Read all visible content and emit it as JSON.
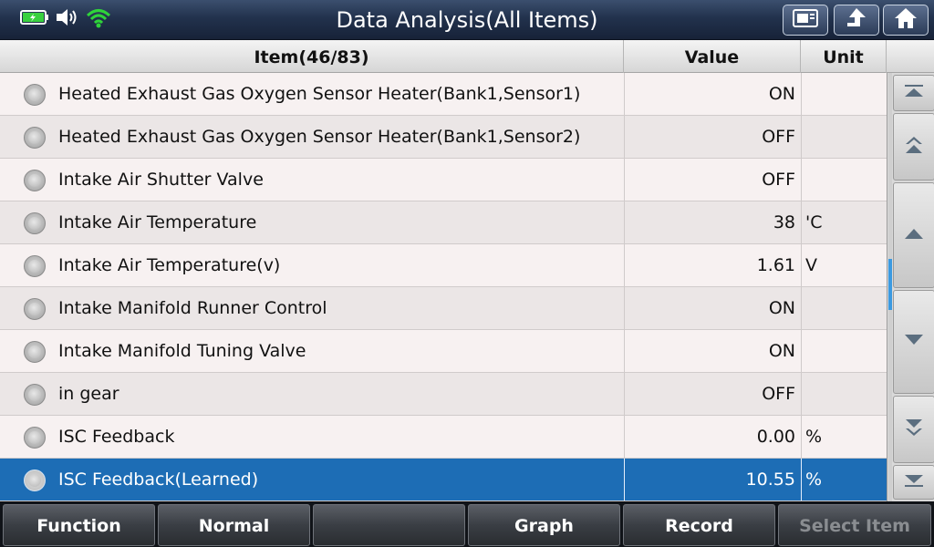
{
  "header": {
    "title": "Data Analysis(All Items)",
    "status_icons": [
      "battery-charging-icon",
      "speaker-volume-icon",
      "wifi-icon"
    ],
    "buttons": [
      "print-screen-icon",
      "back-up-arrow-icon",
      "home-icon"
    ]
  },
  "table": {
    "columns": {
      "item": "Item(46/83)",
      "value": "Value",
      "unit": "Unit"
    },
    "rows": [
      {
        "name": "Heated Exhaust Gas Oxygen Sensor Heater(Bank1,Sensor1)",
        "value": "ON",
        "unit": "",
        "selected": false
      },
      {
        "name": "Heated Exhaust Gas Oxygen Sensor Heater(Bank1,Sensor2)",
        "value": "OFF",
        "unit": "",
        "selected": false
      },
      {
        "name": "Intake Air Shutter Valve",
        "value": "OFF",
        "unit": "",
        "selected": false
      },
      {
        "name": "Intake Air Temperature",
        "value": "38",
        "unit": "'C",
        "selected": false
      },
      {
        "name": "Intake Air Temperature(v)",
        "value": "1.61",
        "unit": "V",
        "selected": false
      },
      {
        "name": "Intake Manifold Runner Control",
        "value": "ON",
        "unit": "",
        "selected": false
      },
      {
        "name": "Intake Manifold Tuning Valve",
        "value": "ON",
        "unit": "",
        "selected": false
      },
      {
        "name": "in gear",
        "value": "OFF",
        "unit": "",
        "selected": false
      },
      {
        "name": "ISC Feedback",
        "value": "0.00",
        "unit": "%",
        "selected": false
      },
      {
        "name": "ISC Feedback(Learned)",
        "value": "10.55",
        "unit": "%",
        "selected": true
      }
    ]
  },
  "scroll": {
    "buttons": [
      "scroll-top-icon",
      "page-up-icon",
      "line-up-icon",
      "line-down-icon",
      "page-down-icon",
      "scroll-bottom-icon"
    ],
    "position_fraction": 0.45
  },
  "footer": {
    "buttons": [
      {
        "label": "Function",
        "enabled": true
      },
      {
        "label": "Normal",
        "enabled": true
      },
      {
        "label": "",
        "enabled": true
      },
      {
        "label": "Graph",
        "enabled": true
      },
      {
        "label": "Record",
        "enabled": true
      },
      {
        "label": "Select Item",
        "enabled": false
      }
    ]
  },
  "colors": {
    "selected_row": "#1d6db5",
    "wifi": "#2fd43a",
    "battery": "#39d13f",
    "scroll_thumb": "#3b9ae1"
  }
}
